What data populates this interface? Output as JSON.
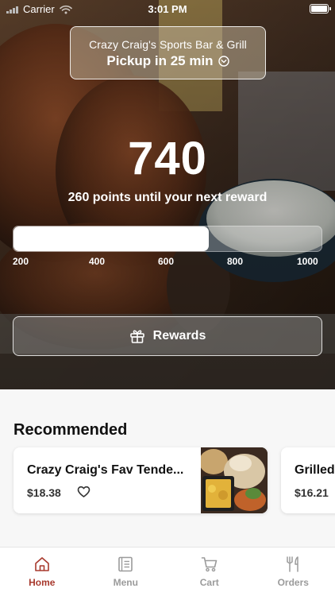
{
  "status_bar": {
    "carrier": "Carrier",
    "time": "3:01 PM"
  },
  "store": {
    "name": "Crazy Craig's Sports Bar & Grill",
    "pickup": "Pickup in 25 min"
  },
  "points": {
    "value": "740",
    "subtitle": "260 points until your next reward",
    "progress_fraction": 0.635,
    "ticks": [
      "200",
      "400",
      "600",
      "800",
      "1000"
    ]
  },
  "rewards_button": {
    "label": "Rewards",
    "icon": "gift-icon"
  },
  "recommended": {
    "title": "Recommended",
    "items": [
      {
        "name": "Crazy Craig's Fav Tende...",
        "price": "$18.38",
        "icon": "heart-icon"
      },
      {
        "name": "Grilled",
        "price": "$16.21"
      }
    ]
  },
  "tabs": [
    {
      "label": "Home",
      "icon": "home-icon",
      "active": true
    },
    {
      "label": "Menu",
      "icon": "menu-icon",
      "active": false
    },
    {
      "label": "Cart",
      "icon": "cart-icon",
      "active": false
    },
    {
      "label": "Orders",
      "icon": "orders-icon",
      "active": false
    }
  ],
  "colors": {
    "accent": "#a83a2e",
    "tab_inactive": "#9b9b9b",
    "text": "#111111"
  }
}
